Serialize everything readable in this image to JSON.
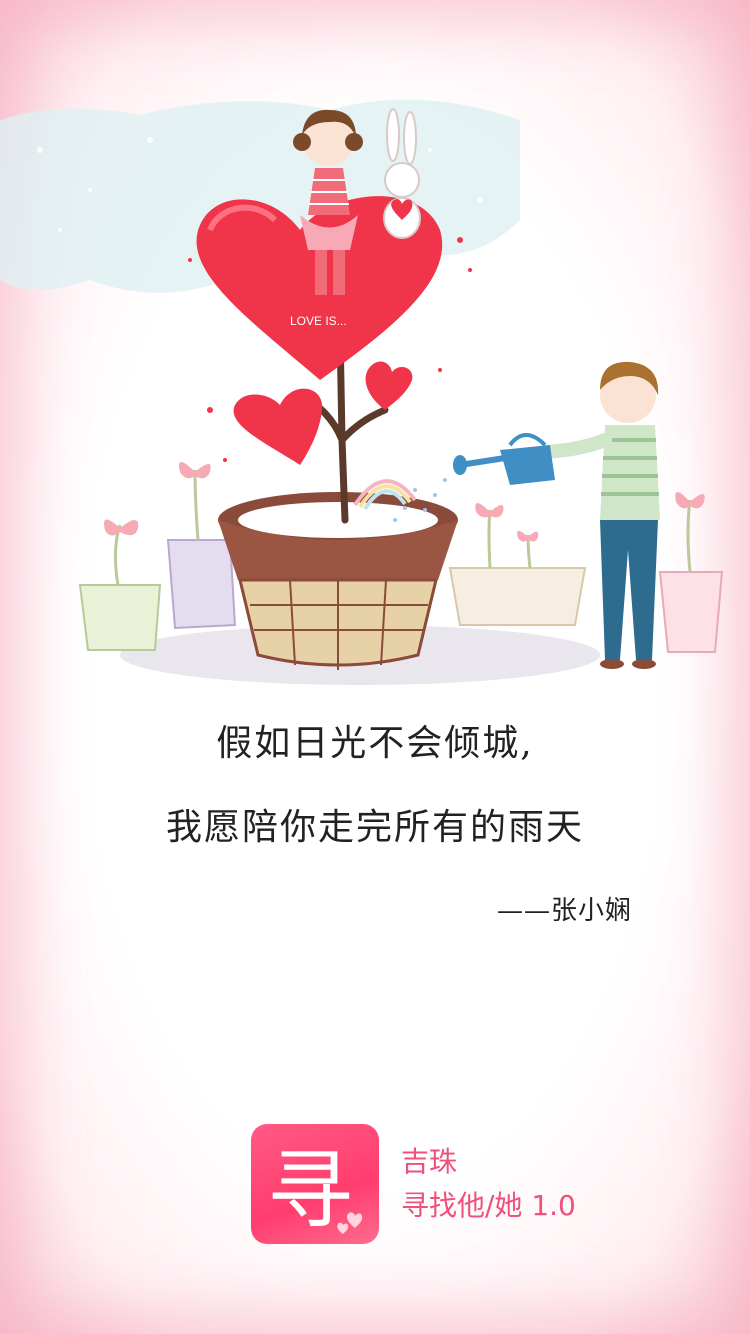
{
  "poem": {
    "line1": "假如日光不会倾城,",
    "line2": "我愿陪你走完所有的雨天",
    "author": "——张小娴"
  },
  "illustration": {
    "sign_text": "LOVE IS..."
  },
  "brand": {
    "icon_glyph": "寻",
    "name": "吉珠",
    "subtitle": "寻找他/她 1.0"
  },
  "colors": {
    "accent": "#f0507a",
    "icon_bg": "#ff4a76",
    "heart": "#f0344a",
    "pot": "#8a4b3a"
  }
}
